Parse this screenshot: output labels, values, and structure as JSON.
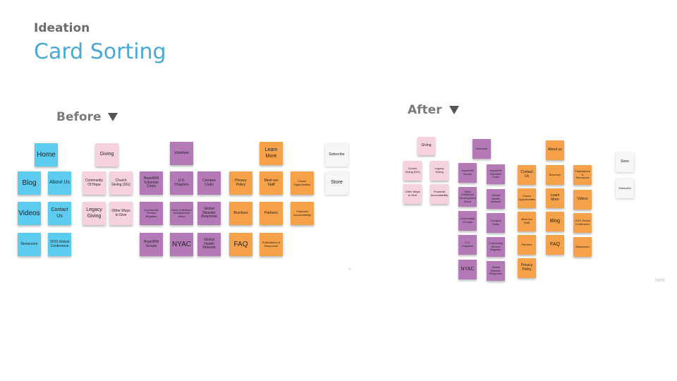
{
  "slide": {
    "subtitle": "Ideation",
    "title": "Card Sorting",
    "before_label": "Before",
    "after_label": "After",
    "watermark": "miro"
  },
  "colors": {
    "blue": "#5ccdf0",
    "pink": "#f6d1e0",
    "purple": "#b47ab8",
    "orange": "#f5a24a",
    "white": "#f6f6f6",
    "title": "#4aa8d6"
  },
  "before": {
    "blue": [
      "Home",
      "Blog",
      "About Us",
      "Videos",
      "Contact Us",
      "Newsroom",
      "2019 Global Conference"
    ],
    "pink": [
      "Giving",
      "Community Of Hope",
      "Church Giving (DG)",
      "Legacy Giving",
      "Other Ways to Give"
    ],
    "purple": [
      "Volunteer",
      "HopeWW Volunteer Corps",
      "U.S. Chapters",
      "Campus Clubs",
      "Community Service Brigades",
      "Early Childhood Development Africa",
      "Global Disaster Response",
      "HopeWW Scouts",
      "NYAC",
      "Global Health Network"
    ],
    "orange": [
      "Learn More",
      "Privacy Policy",
      "Meet our Staff",
      "Career Opportunities",
      "Brochure",
      "Partners",
      "Financial Accountability",
      "FAQ",
      "Publications & Resources"
    ],
    "white": [
      "Subscribe",
      "Store"
    ]
  },
  "after": {
    "pink": [
      "Giving",
      "Church Giving (DG)",
      "Legacy Giving",
      "Other Ways to Give",
      "Financial Accountability"
    ],
    "purple": [
      "Volunteer",
      "HopeWW Scouts",
      "HopeWW Volunteer Corps",
      "Early Childhood Development Africa",
      "Global Health Network",
      "Community Of Hope",
      "Campus Clubs",
      "U.S. Chapters",
      "Community Service Brigades",
      "NYAC",
      "Global Disaster Response"
    ],
    "orange": [
      "About us",
      "Contact Us",
      "Brochure",
      "Publications & Resources",
      "Career Opportunities",
      "Learn More",
      "Videos",
      "Meet our Staff",
      "Blog",
      "2019 Global Conference",
      "Partners",
      "FAQ",
      "Newsroom",
      "Privacy Policy"
    ],
    "white": [
      "Store",
      "Subscribe"
    ]
  }
}
